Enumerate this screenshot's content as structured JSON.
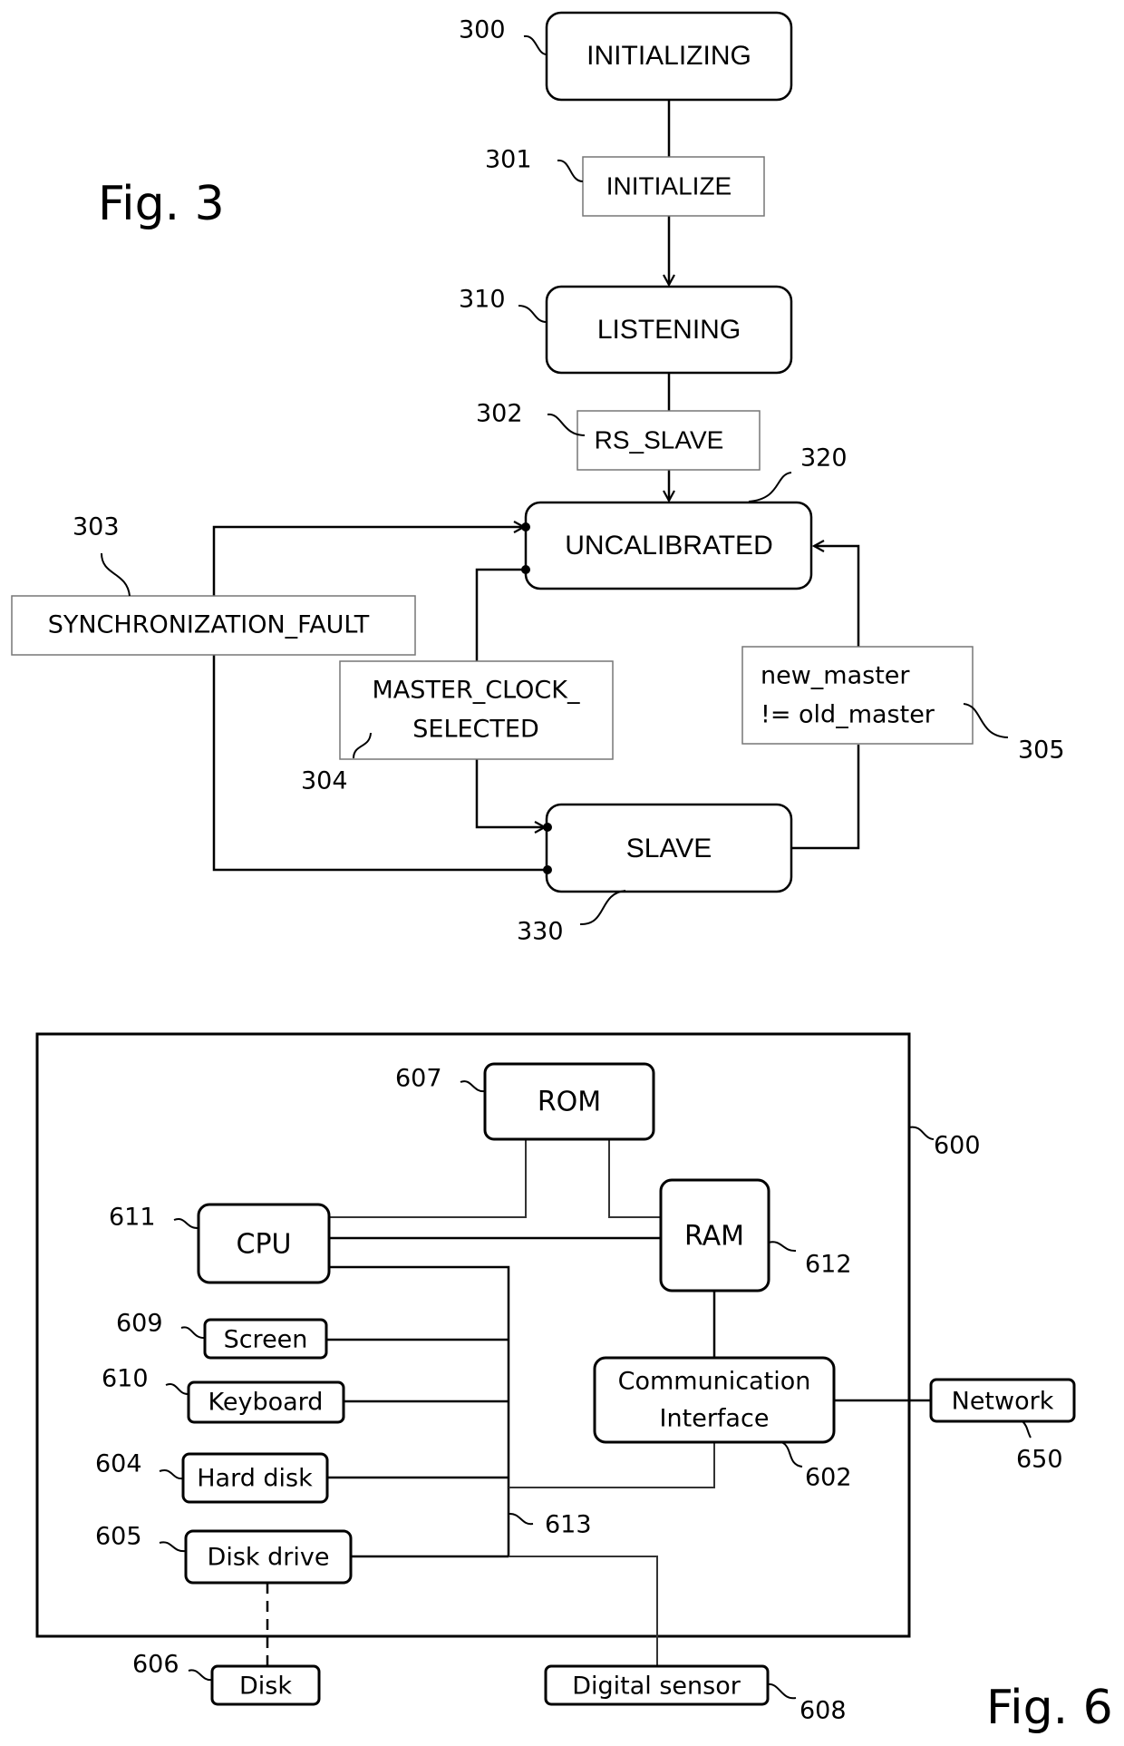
{
  "fig3": {
    "title": "Fig. 3",
    "states": {
      "initializing": {
        "label": "INITIALIZING",
        "ref": "300"
      },
      "listening": {
        "label": "LISTENING",
        "ref": "310"
      },
      "uncalibrated": {
        "label": "UNCALIBRATED",
        "ref": "320"
      },
      "slave": {
        "label": "SLAVE",
        "ref": "330"
      }
    },
    "transitions": {
      "initialize": {
        "label": "INITIALIZE",
        "ref": "301"
      },
      "rs_slave": {
        "label": "RS_SLAVE",
        "ref": "302"
      },
      "sync_fault": {
        "label": "SYNCHRONIZATION_FAULT",
        "ref": "303"
      },
      "master_clock": {
        "line1": "MASTER_CLOCK_",
        "line2": "SELECTED",
        "ref": "304"
      },
      "new_master": {
        "line1": "new_master",
        "line2": "!= old_master",
        "ref": "305"
      }
    }
  },
  "fig6": {
    "title": "Fig. 6",
    "device_ref": "600",
    "bus_ref": "613",
    "blocks": {
      "rom": {
        "label": "ROM",
        "ref": "607"
      },
      "cpu": {
        "label": "CPU",
        "ref": "611"
      },
      "ram": {
        "label": "RAM",
        "ref": "612"
      },
      "screen": {
        "label": "Screen",
        "ref": "609"
      },
      "keyboard": {
        "label": "Keyboard",
        "ref": "610"
      },
      "hard_disk": {
        "label": "Hard disk",
        "ref": "604"
      },
      "disk_drive": {
        "label": "Disk drive",
        "ref": "605"
      },
      "comm": {
        "line1": "Communication",
        "line2": "Interface",
        "ref": "602"
      },
      "disk": {
        "label": "Disk",
        "ref": "606"
      },
      "digital_sensor": {
        "label": "Digital sensor",
        "ref": "608"
      },
      "network": {
        "label": "Network",
        "ref": "650"
      }
    }
  }
}
